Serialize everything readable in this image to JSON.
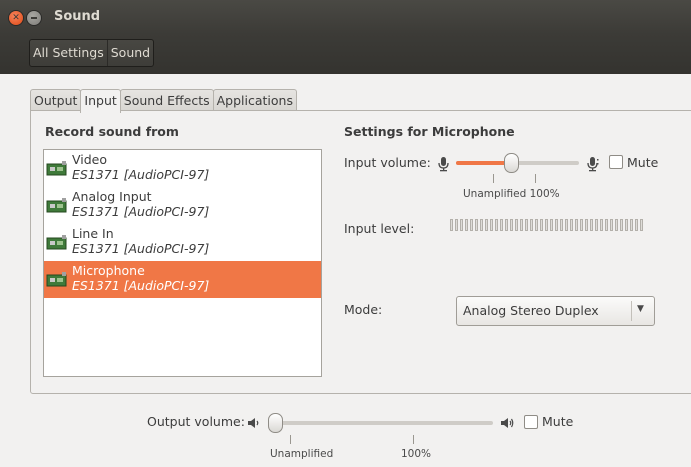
{
  "window": {
    "title": "Sound"
  },
  "toolbar": {
    "all_settings": "All Settings",
    "sound": "Sound"
  },
  "tabs": [
    {
      "label": "Output"
    },
    {
      "label": "Input",
      "active": true
    },
    {
      "label": "Sound Effects"
    },
    {
      "label": "Applications"
    }
  ],
  "record": {
    "heading": "Record sound from",
    "devices": [
      {
        "name": "Video",
        "card": "ES1371 [AudioPCI-97]"
      },
      {
        "name": "Analog Input",
        "card": "ES1371 [AudioPCI-97]"
      },
      {
        "name": "Line In",
        "card": "ES1371 [AudioPCI-97]"
      },
      {
        "name": "Microphone",
        "card": "ES1371 [AudioPCI-97]",
        "selected": true
      }
    ]
  },
  "settings": {
    "heading": "Settings for Microphone",
    "input_volume_label": "Input volume:",
    "input_volume_fraction": 0.45,
    "unamplified_100": "Unamplified 100%",
    "mute_label": "Mute",
    "input_level_label": "Input level:",
    "mode_label": "Mode:",
    "mode_value": "Analog Stereo Duplex"
  },
  "output": {
    "label": "Output volume:",
    "volume_fraction": 0.02,
    "mute_label": "Mute",
    "unamplified": "Unamplified",
    "hundred": "100%"
  },
  "colors": {
    "accent": "#f07746",
    "titlebar": "#3c3b37"
  },
  "icons": [
    "close-icon",
    "minimize-icon",
    "sound-card-icon",
    "microphone-icon",
    "speaker-icon",
    "chevron-down-icon"
  ]
}
